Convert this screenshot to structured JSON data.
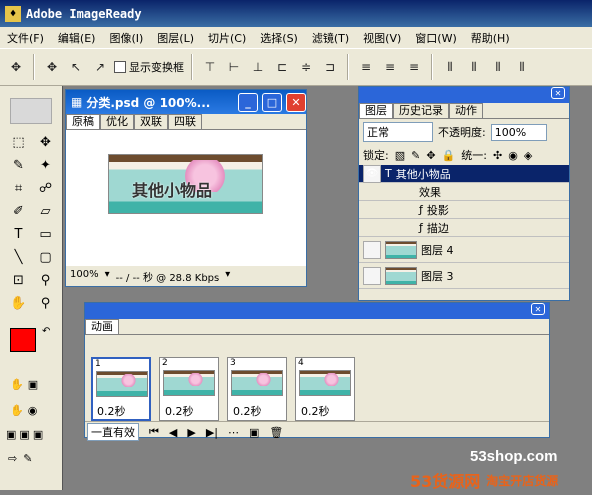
{
  "app": {
    "title": "Adobe ImageReady",
    "logo": "♦"
  },
  "menu": [
    "文件(F)",
    "编辑(E)",
    "图像(I)",
    "图层(L)",
    "切片(C)",
    "选择(S)",
    "滤镜(T)",
    "视图(V)",
    "窗口(W)",
    "帮助(H)"
  ],
  "options": {
    "transform_label": "显示变换框"
  },
  "doc": {
    "title": "分类.psd @ 100%...",
    "tabs": [
      "原稿",
      "优化",
      "双联",
      "四联"
    ],
    "zoom": "100%",
    "status": "-- / -- 秒 @ 28.8 Kbps",
    "thumb_text": "其他小物品"
  },
  "layers": {
    "tabs": [
      "图层",
      "历史记录",
      "动作"
    ],
    "blend": "正常",
    "opacity_label": "不透明度:",
    "opacity": "100%",
    "lock_label": "锁定:",
    "unify_label": "统一:",
    "top_layer": "其他小物品",
    "effects_label": "效果",
    "effect1": "投影",
    "effect2": "描边",
    "layer4": "图层 4",
    "layer3": "图层 3"
  },
  "anim": {
    "title": "动画",
    "frames": [
      {
        "num": "1",
        "delay": "0.2秒"
      },
      {
        "num": "2",
        "delay": "0.2秒"
      },
      {
        "num": "3",
        "delay": "0.2秒"
      },
      {
        "num": "4",
        "delay": "0.2秒"
      }
    ],
    "loop": "一直有效"
  },
  "watermark": {
    "url": "53shop.com",
    "brand": "53货源网",
    "slogan": "淘宝开店货源"
  }
}
